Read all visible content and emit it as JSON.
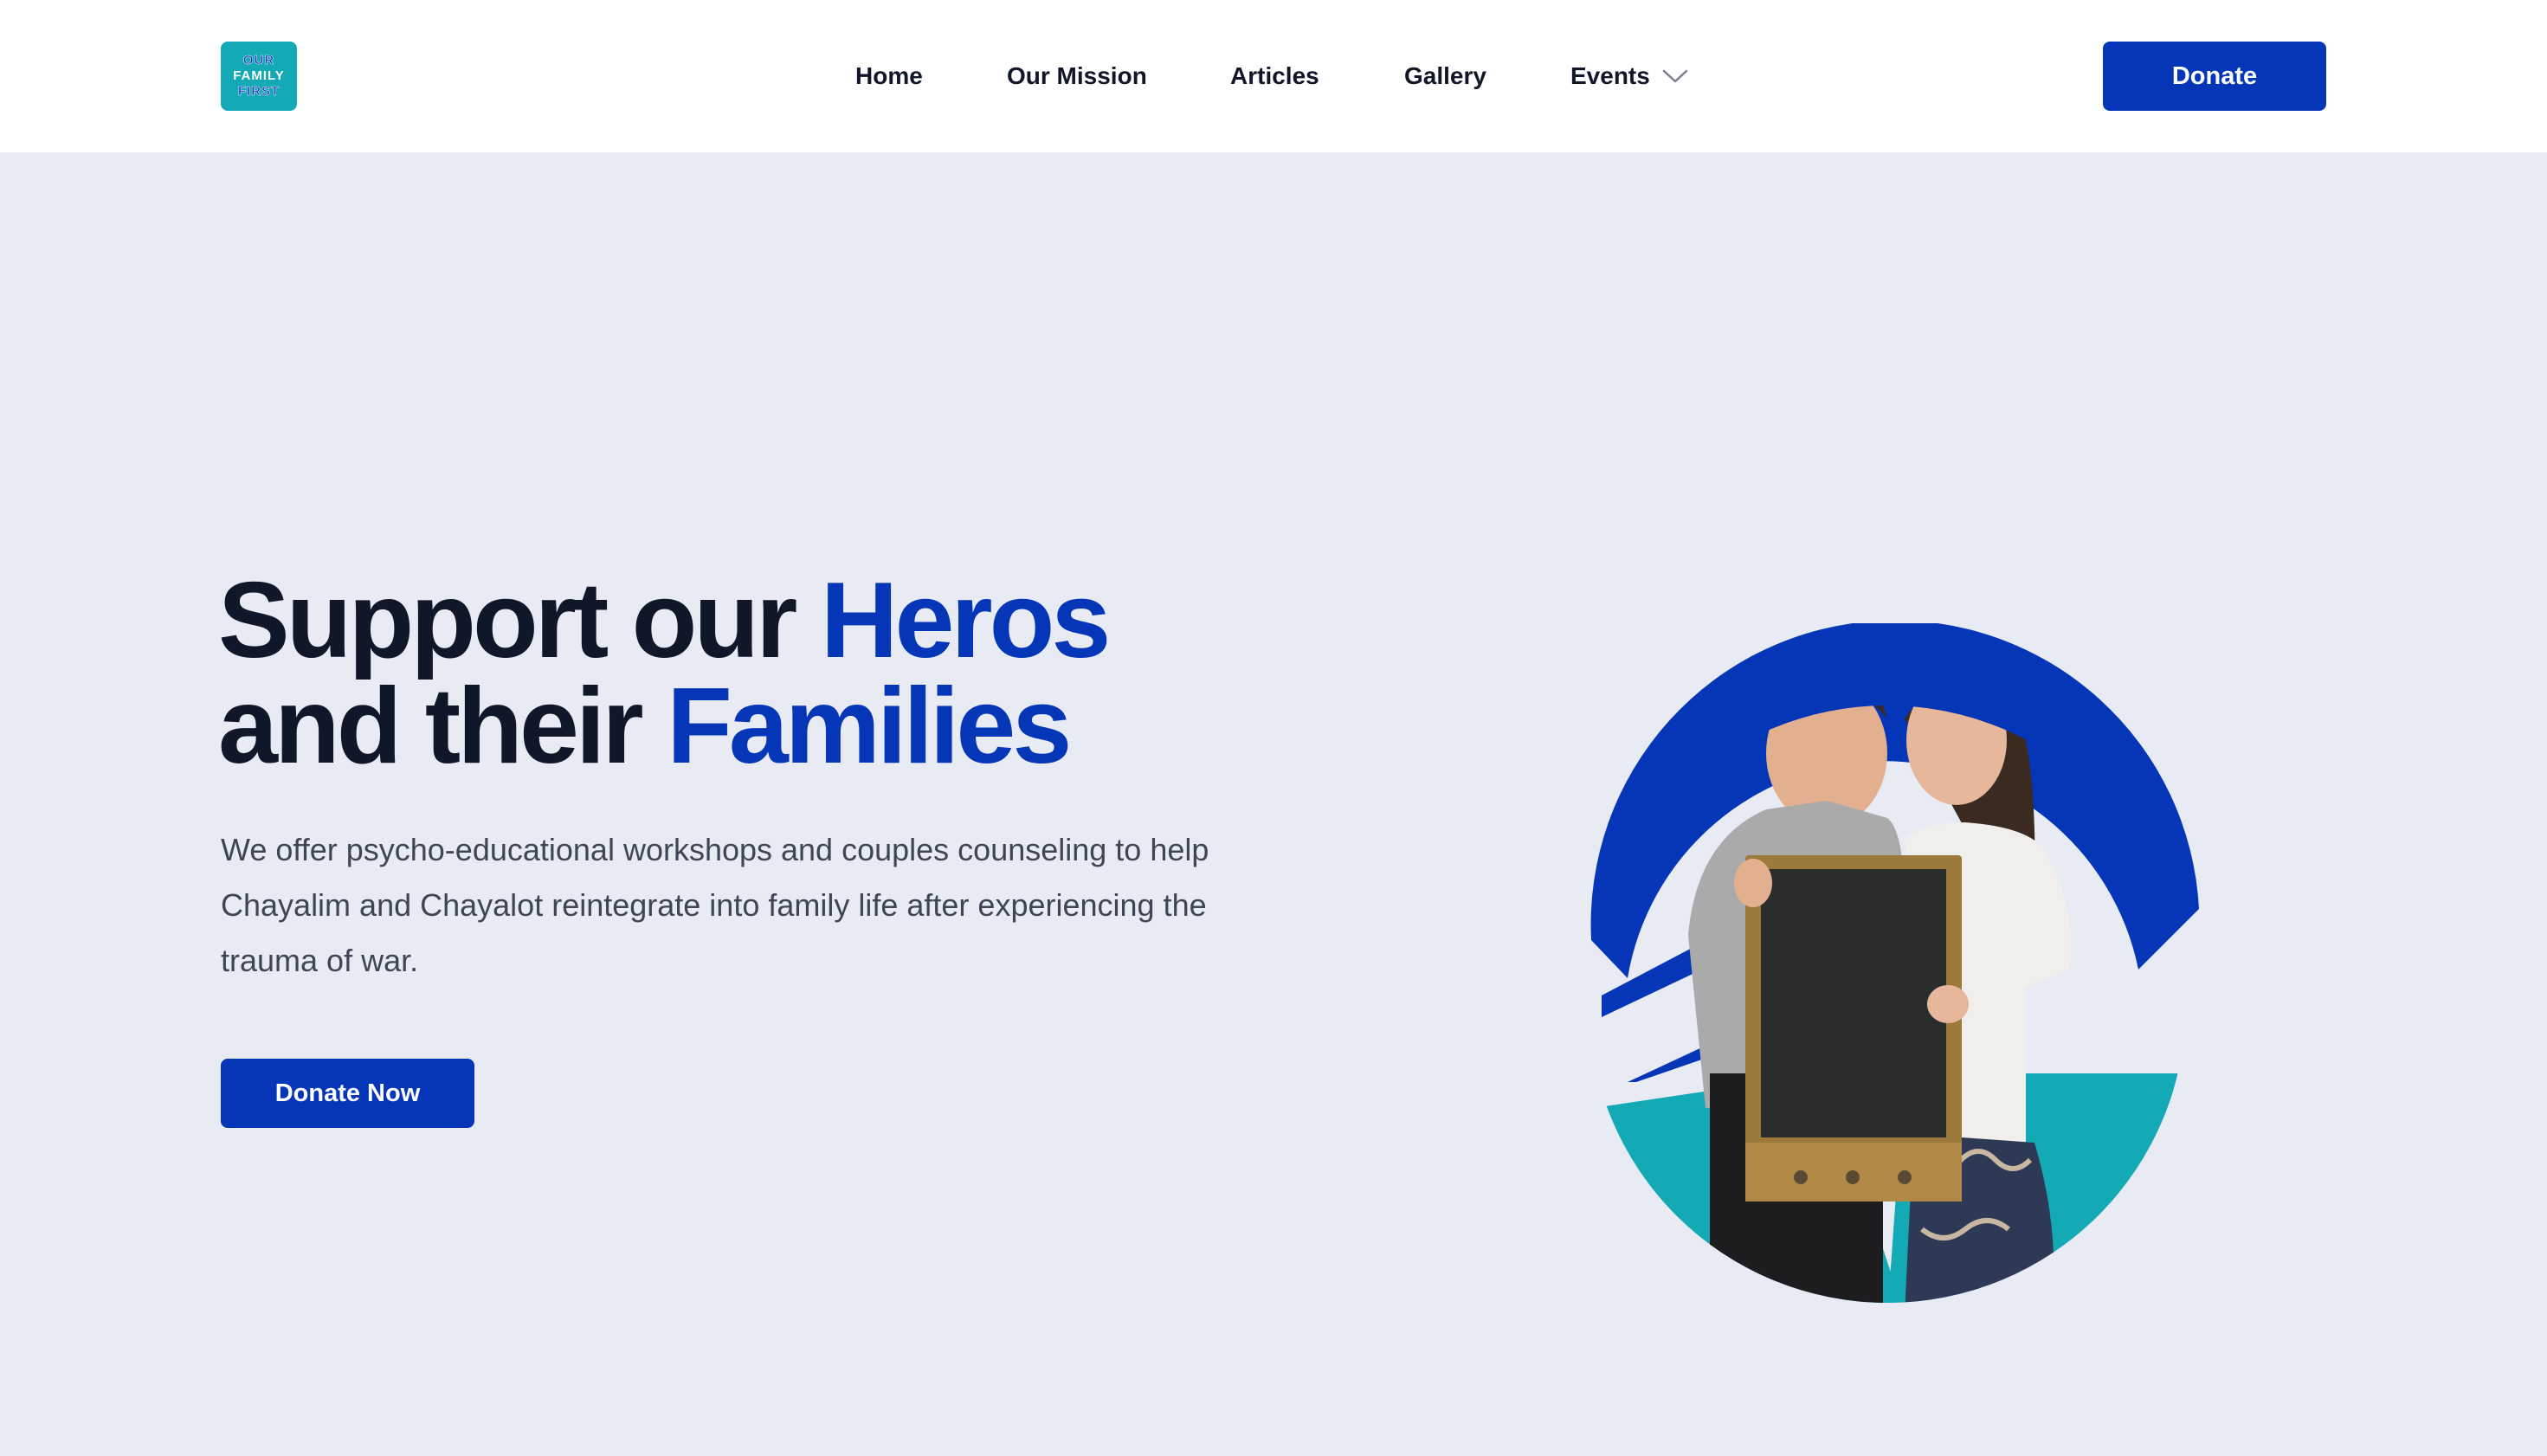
{
  "header": {
    "logo": {
      "line1": "OUR",
      "line2": "FAMILY",
      "line3": "FIRST"
    },
    "nav": {
      "home": "Home",
      "mission": "Our Mission",
      "articles": "Articles",
      "gallery": "Gallery",
      "events": "Events"
    },
    "donate_label": "Donate"
  },
  "hero": {
    "title_part1": "Support our ",
    "title_accent1": "Heros",
    "title_part2": "and their ",
    "title_accent2": "Families",
    "description": "We offer psycho-educational workshops and couples counseling to help Chayalim and Chayalot reintegrate into family life after experiencing the trauma of war.",
    "cta_label": "Donate Now",
    "image_icon": "couple-photo"
  },
  "colors": {
    "brand_blue": "#0536b8",
    "teal": "#13a9b5",
    "page_bg": "#e8ebf4",
    "text_dark": "#0f1729"
  }
}
